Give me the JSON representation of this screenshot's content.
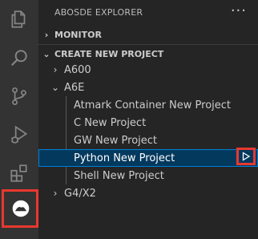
{
  "sidebar": {
    "title": "ABOSDE EXPLORER",
    "more_label": "···",
    "sections": {
      "monitor": {
        "label": "MONITOR",
        "chevron": "›"
      },
      "create": {
        "label": "CREATE NEW PROJECT",
        "chevron": "⌄"
      }
    },
    "tree": {
      "a600": {
        "label": "A600",
        "chevron": "›"
      },
      "a6e": {
        "label": "A6E",
        "chevron": "⌄",
        "items": [
          "Atmark Container New Project",
          "C New Project",
          "GW New Project",
          "Python New Project",
          "Shell New Project"
        ]
      },
      "g4x2": {
        "label": "G4/X2",
        "chevron": "›"
      }
    }
  },
  "activity_bar": {
    "icons": [
      "files-icon",
      "search-icon",
      "source-control-icon",
      "run-debug-icon",
      "extensions-icon",
      "abosde-icon"
    ]
  },
  "colors": {
    "highlight": "#e8382f",
    "selection": "#04395e",
    "focus_border": "#007fd4"
  }
}
